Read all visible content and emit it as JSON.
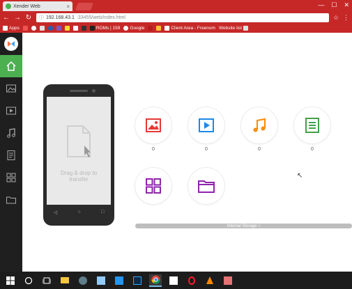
{
  "browser": {
    "tab_title": "Xender Web",
    "tab_close": "×",
    "url_host": "192.168.43.1",
    "url_rest": ":33455/web/index.html",
    "window_controls": [
      "—",
      "☐",
      "✕"
    ],
    "bookmarks": [
      "Apps",
      "ROMs | 159",
      "Google",
      "Client Area - Freenom",
      "Website list"
    ]
  },
  "app": {
    "phone": {
      "drop_text_line1": "Drag & drop to",
      "drop_text_line2": "transfer",
      "nav_buttons": [
        "◁",
        "○",
        "□"
      ]
    },
    "categories": [
      {
        "name": "photos",
        "count": "0",
        "color": "#e53935"
      },
      {
        "name": "videos",
        "count": "0",
        "color": "#1e88e5"
      },
      {
        "name": "music",
        "count": "0",
        "color": "#fb8c00"
      },
      {
        "name": "documents",
        "count": "0",
        "color": "#43a047"
      },
      {
        "name": "apps",
        "count": "",
        "color": "#8e24aa"
      },
      {
        "name": "folder",
        "count": "",
        "color": "#8e24aa"
      }
    ],
    "storage_label": "Internal Storage: /"
  },
  "colors": {
    "chrome_red": "#c62828",
    "sidebar_bg": "#1f1f1f",
    "sidebar_active": "#4caf50"
  }
}
